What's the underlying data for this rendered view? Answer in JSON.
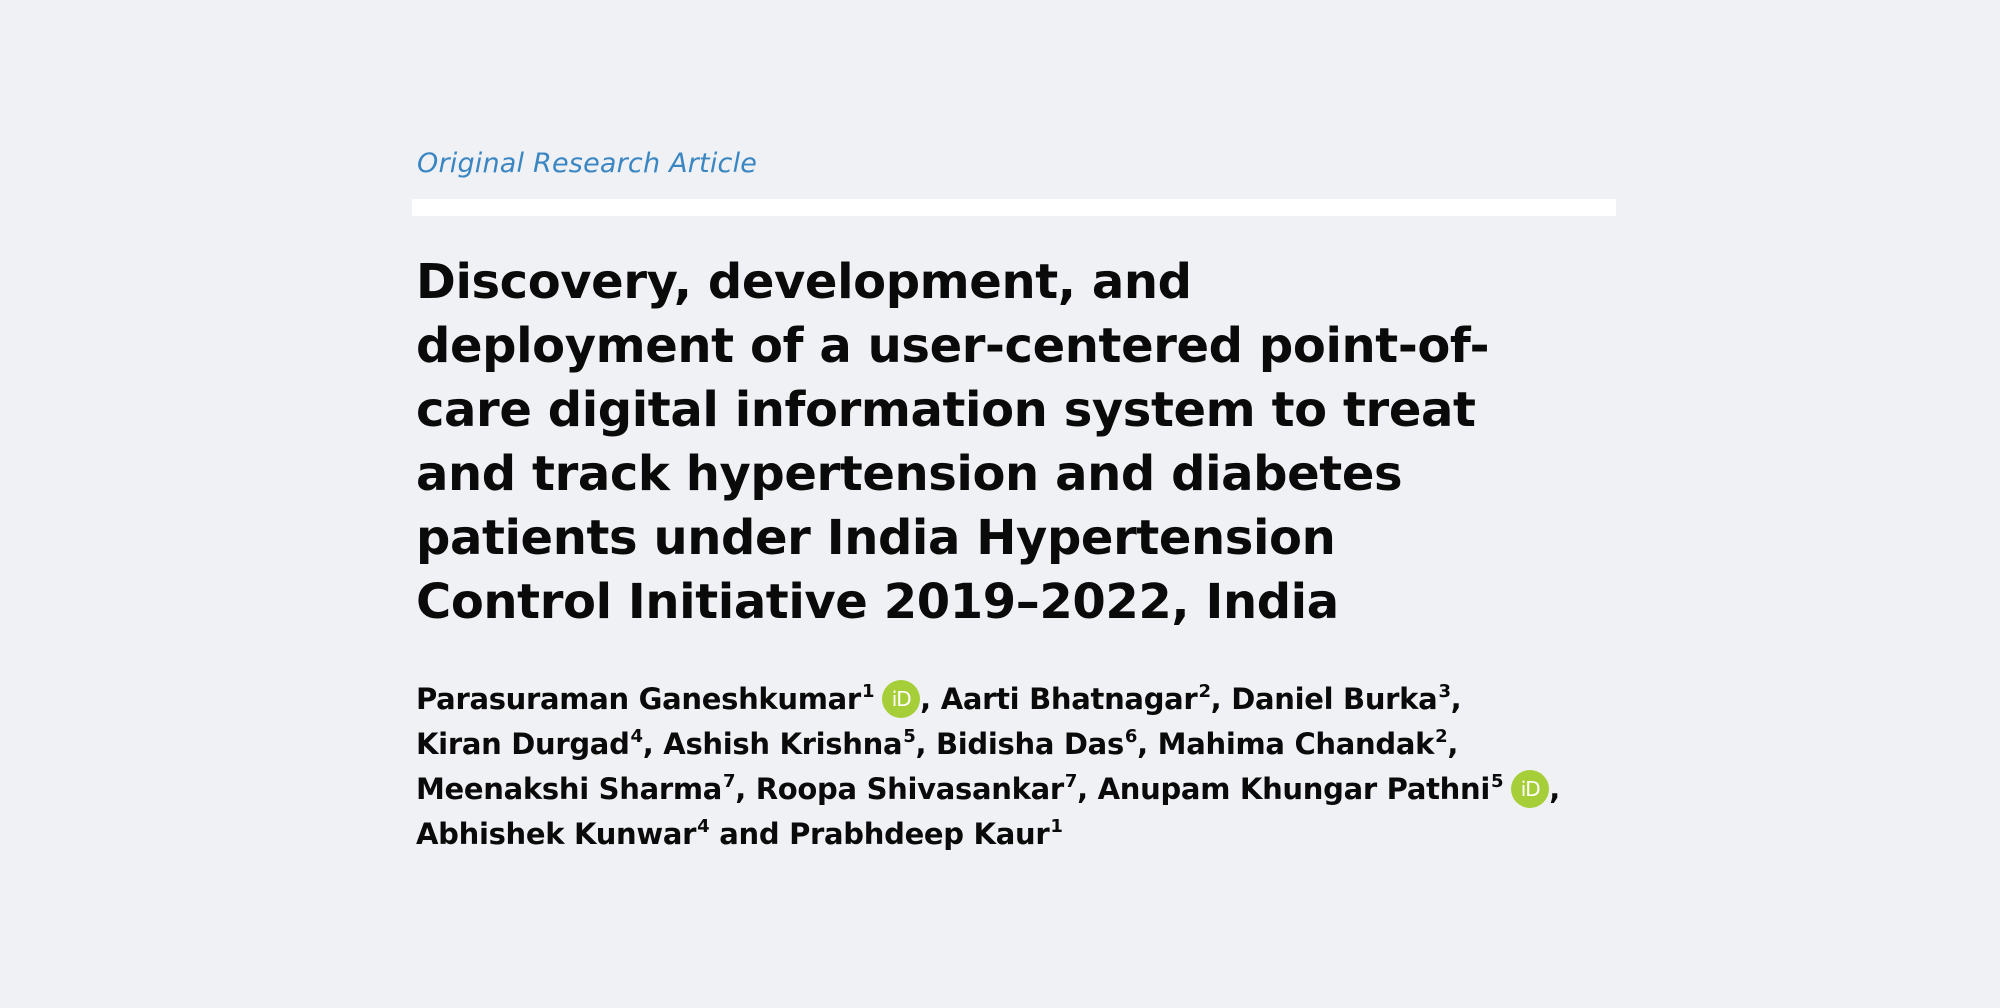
{
  "article_type": "Original Research Article",
  "title": "Discovery, development, and deployment of a user-centered point-of-care digital information system to treat and track hypertension and diabetes patients under India Hypertension Control Initiative 2019–2022, India",
  "orcid_icon_text": "iD",
  "colors": {
    "background": "#f0f1f5",
    "article_type": "#3a86c2",
    "divider": "#ffffff",
    "text": "#0a0a0a",
    "orcid": "#a6ce39"
  },
  "authors": [
    {
      "name": "Parasuraman Ganeshkumar",
      "affiliation": "1",
      "orcid": true,
      "separator": ", "
    },
    {
      "name": "Aarti Bhatnagar",
      "affiliation": "2",
      "orcid": false,
      "separator": ", "
    },
    {
      "name": "Daniel Burka",
      "affiliation": "3",
      "orcid": false,
      "separator": ", "
    },
    {
      "name": "Kiran Durgad",
      "affiliation": "4",
      "orcid": false,
      "separator": ", "
    },
    {
      "name": "Ashish Krishna",
      "affiliation": "5",
      "orcid": false,
      "separator": ", "
    },
    {
      "name": "Bidisha Das",
      "affiliation": "6",
      "orcid": false,
      "separator": ", "
    },
    {
      "name": "Mahima Chandak",
      "affiliation": "2",
      "orcid": false,
      "separator": ", "
    },
    {
      "name": "Meenakshi Sharma",
      "affiliation": "7",
      "orcid": false,
      "separator": ", "
    },
    {
      "name": "Roopa Shivasankar",
      "affiliation": "7",
      "orcid": false,
      "separator": ", "
    },
    {
      "name": "Anupam Khungar Pathni",
      "affiliation": "5",
      "orcid": true,
      "separator": ", "
    },
    {
      "name": "Abhishek Kunwar",
      "affiliation": "4",
      "orcid": false,
      "separator": " and "
    },
    {
      "name": "Prabhdeep Kaur",
      "affiliation": "1",
      "orcid": false,
      "separator": ""
    }
  ]
}
